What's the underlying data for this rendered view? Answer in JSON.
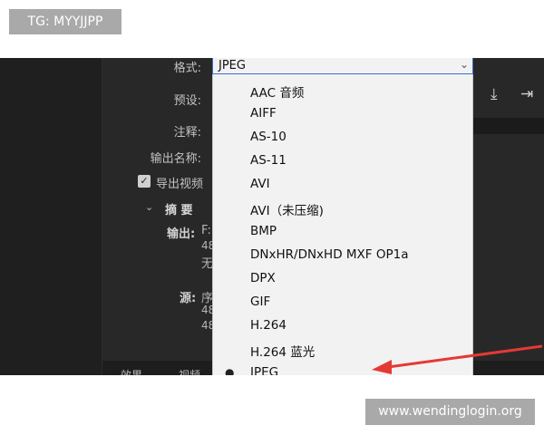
{
  "tag_text": "TG: MYYJJPP",
  "watermark_text": "www.wendinglogin.org",
  "labels": {
    "format": "格式:",
    "preset": "预设:",
    "comment": "注释:",
    "output_name": "输出名称:",
    "export_video": "导出视频",
    "summary": "摘 要",
    "output": "输出:",
    "source": "源:"
  },
  "fragments": [
    "F:",
    "48",
    "无",
    "序",
    "48",
    "48"
  ],
  "tabs": [
    "效果",
    "视频"
  ],
  "format_dropdown": {
    "selected": "JPEG",
    "options": [
      "AAC 音频",
      "AIFF",
      "AS-10",
      "AS-11",
      "AVI",
      "AVI（未压缩)",
      "BMP",
      "DNxHR/DNxHD MXF OP1a",
      "DPX",
      "GIF",
      "H.264",
      "H.264 蓝光",
      "JPEG"
    ],
    "checked_index": 12
  },
  "icons": [
    "checkbox-check-icon",
    "chevron-down-icon",
    "download-icon",
    "import-icon",
    "arrow-icon"
  ],
  "colors": {
    "dark_bg": "#232323",
    "dropdown_bg": "#f2f2f2",
    "arrow": "#e53935",
    "tag_bg": "#a9a9a9"
  }
}
